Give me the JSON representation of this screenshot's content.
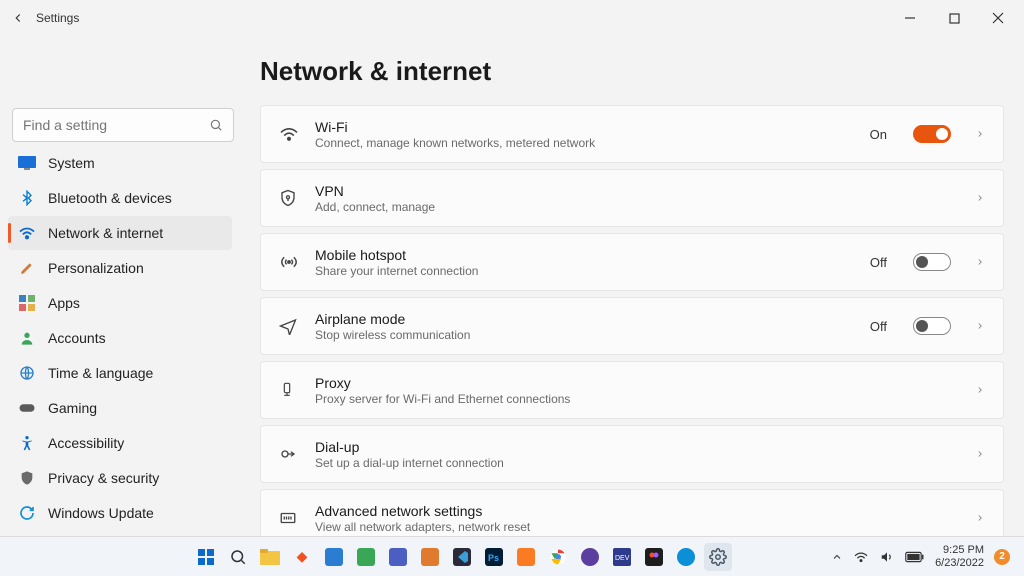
{
  "window": {
    "title": "Settings"
  },
  "search": {
    "placeholder": "Find a setting"
  },
  "sidebar": {
    "items": [
      {
        "label": "System"
      },
      {
        "label": "Bluetooth & devices"
      },
      {
        "label": "Network & internet"
      },
      {
        "label": "Personalization"
      },
      {
        "label": "Apps"
      },
      {
        "label": "Accounts"
      },
      {
        "label": "Time & language"
      },
      {
        "label": "Gaming"
      },
      {
        "label": "Accessibility"
      },
      {
        "label": "Privacy & security"
      },
      {
        "label": "Windows Update"
      }
    ]
  },
  "page": {
    "title": "Network & internet"
  },
  "cards": {
    "wifi": {
      "title": "Wi-Fi",
      "sub": "Connect, manage known networks, metered network",
      "state": "On"
    },
    "vpn": {
      "title": "VPN",
      "sub": "Add, connect, manage"
    },
    "hotspot": {
      "title": "Mobile hotspot",
      "sub": "Share your internet connection",
      "state": "Off"
    },
    "airplane": {
      "title": "Airplane mode",
      "sub": "Stop wireless communication",
      "state": "Off"
    },
    "proxy": {
      "title": "Proxy",
      "sub": "Proxy server for Wi-Fi and Ethernet connections"
    },
    "dialup": {
      "title": "Dial-up",
      "sub": "Set up a dial-up internet connection"
    },
    "advanced": {
      "title": "Advanced network settings",
      "sub": "View all network adapters, network reset"
    }
  },
  "taskbar": {
    "time": "9:25 PM",
    "date": "6/23/2022",
    "notif_count": "2"
  }
}
